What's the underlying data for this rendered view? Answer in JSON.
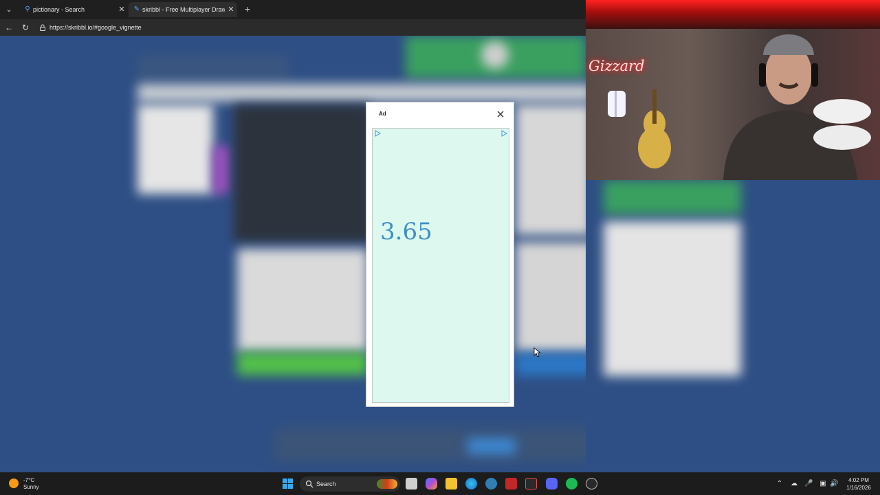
{
  "browser": {
    "tabs": [
      {
        "label": "pictionary - Search",
        "icon": "search-icon"
      },
      {
        "label": "skribbl - Free Multiplayer Drawing",
        "icon": "pencil-icon"
      }
    ],
    "url": "https://skribbl.io/#google_vignette"
  },
  "webcam": {
    "neon_sign": "Gizzard"
  },
  "ad_modal": {
    "label": "Ad",
    "price": "3.65"
  },
  "taskbar": {
    "weather": {
      "temp": "-7°C",
      "condition": "Sunny"
    },
    "search_label": "Search",
    "clock": {
      "time": "4:02 PM",
      "date": "1/16/2026"
    }
  }
}
